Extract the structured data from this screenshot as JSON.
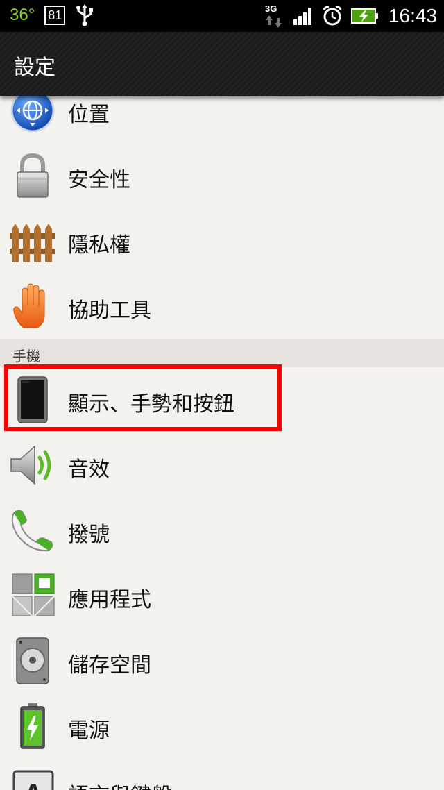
{
  "status_bar": {
    "temperature": "36°",
    "notification_count": "81",
    "network": "3G",
    "time": "16:43",
    "accent_color": "#8fd62a"
  },
  "title_bar": {
    "title": "設定"
  },
  "settings": {
    "items_top": [
      {
        "label": "位置",
        "icon": "location-globe-icon"
      },
      {
        "label": "安全性",
        "icon": "lock-icon"
      },
      {
        "label": "隱私權",
        "icon": "fence-icon"
      },
      {
        "label": "協助工具",
        "icon": "hand-icon"
      }
    ],
    "section_phone": {
      "header": "手機"
    },
    "items_phone": [
      {
        "label": "顯示、手勢和按鈕",
        "icon": "phone-display-icon",
        "highlighted": true
      },
      {
        "label": "音效",
        "icon": "speaker-icon"
      },
      {
        "label": "撥號",
        "icon": "handset-icon"
      },
      {
        "label": "應用程式",
        "icon": "apps-grid-icon"
      },
      {
        "label": "儲存空間",
        "icon": "storage-drive-icon"
      },
      {
        "label": "電源",
        "icon": "battery-icon"
      },
      {
        "label": "語言與鍵盤",
        "icon": "keyboard-letter-icon"
      }
    ]
  },
  "highlight_color": "#ff0000"
}
